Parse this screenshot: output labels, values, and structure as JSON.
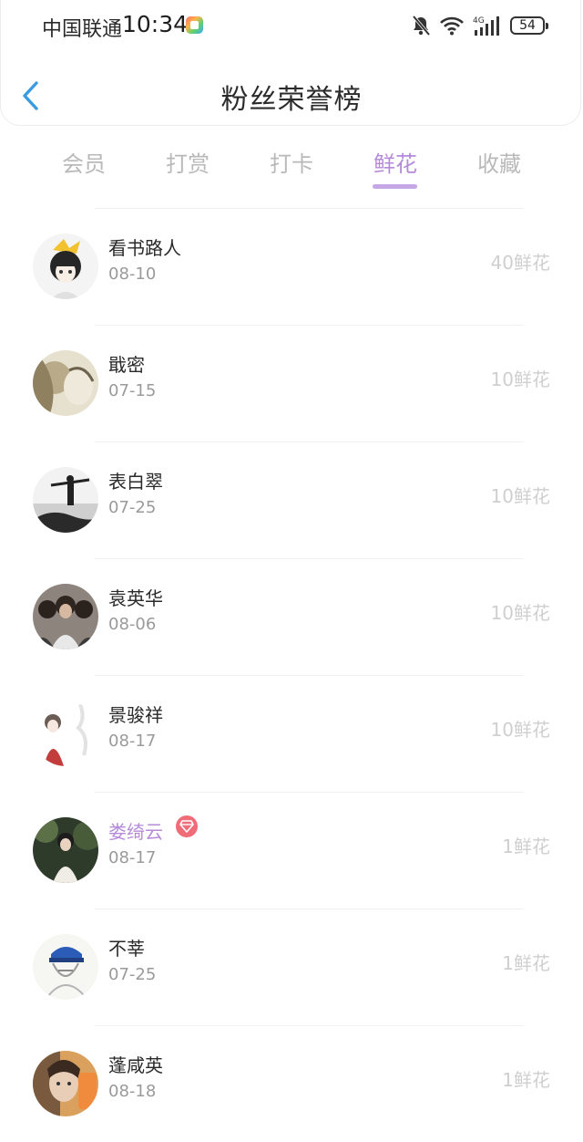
{
  "status_bar": {
    "carrier": "中国联通",
    "time": "10:34",
    "battery": "54",
    "network": "4G"
  },
  "header": {
    "title": "粉丝荣誉榜"
  },
  "tabs": [
    {
      "label": "会员",
      "active": false
    },
    {
      "label": "打赏",
      "active": false
    },
    {
      "label": "打卡",
      "active": false
    },
    {
      "label": "鲜花",
      "active": true
    },
    {
      "label": "收藏",
      "active": false
    }
  ],
  "accent_color": "#b58ad8",
  "list": [
    {
      "name": "看书路人",
      "date": "08-10",
      "score": "40鲜花",
      "avatar": "anime-boy-avatar"
    },
    {
      "name": "戢密",
      "date": "07-15",
      "score": "10鲜花",
      "avatar": "painting-avatar"
    },
    {
      "name": "表白翠",
      "date": "07-25",
      "score": "10鲜花",
      "avatar": "silhouette-avatar"
    },
    {
      "name": "袁英华",
      "date": "08-06",
      "score": "10鲜花",
      "avatar": "group-photo-avatar"
    },
    {
      "name": "景骏祥",
      "date": "08-17",
      "score": "10鲜花",
      "avatar": "illustration-avatar"
    },
    {
      "name": "娄绮云",
      "date": "08-17",
      "score": "1鲜花",
      "avatar": "forest-girl-avatar",
      "vip": true
    },
    {
      "name": "不莘",
      "date": "07-25",
      "score": "1鲜花",
      "avatar": "sketch-avatar"
    },
    {
      "name": "蓬咸英",
      "date": "08-18",
      "score": "1鲜花",
      "avatar": "selfie-avatar"
    }
  ]
}
